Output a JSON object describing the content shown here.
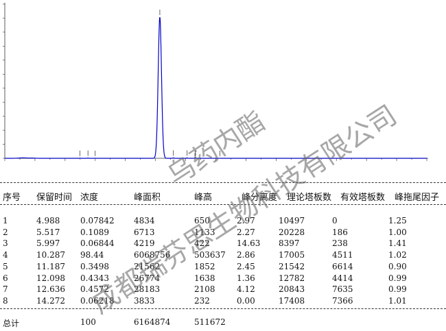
{
  "chart_data": {
    "type": "line",
    "title": "",
    "xlabel": "",
    "ylabel": "",
    "ylim": [
      0,
      550000
    ],
    "xlim": [
      0,
      28
    ],
    "grid": false,
    "line_color": "#0000c8",
    "peaks": [
      {
        "rt": 4.988,
        "height": 650
      },
      {
        "rt": 5.517,
        "height": 1133
      },
      {
        "rt": 5.997,
        "height": 422
      },
      {
        "rt": 10.287,
        "height": 503637
      },
      {
        "rt": 11.187,
        "height": 1852
      },
      {
        "rt": 12.098,
        "height": 1638
      },
      {
        "rt": 12.636,
        "height": 2108
      },
      {
        "rt": 14.272,
        "height": 232
      }
    ]
  },
  "table": {
    "headers": [
      "序号",
      "保留时间",
      "浓度",
      "峰面积",
      "峰高",
      "峰分离度",
      "理论塔板数",
      "有效塔板数",
      "峰拖尾因子"
    ],
    "rows": [
      [
        "1",
        "4.988",
        "0.07842",
        "4834",
        "650",
        "2.97",
        "10497",
        "0",
        "1.25"
      ],
      [
        "2",
        "5.517",
        "0.1089",
        "6713",
        "1133",
        "2.27",
        "20228",
        "186",
        "1.00"
      ],
      [
        "3",
        "5.997",
        "0.06844",
        "4219",
        "422",
        "14.63",
        "8397",
        "238",
        "1.41"
      ],
      [
        "4",
        "10.287",
        "98.44",
        "6068756",
        "503637",
        "2.86",
        "17005",
        "4511",
        "1.02"
      ],
      [
        "5",
        "11.187",
        "0.3498",
        "21562",
        "1852",
        "2.45",
        "21542",
        "6614",
        "0.90"
      ],
      [
        "6",
        "12.098",
        "0.4343",
        "26774",
        "1638",
        "1.36",
        "12782",
        "4414",
        "0.99"
      ],
      [
        "7",
        "12.636",
        "0.4572",
        "28183",
        "2108",
        "4.12",
        "20843",
        "7635",
        "0.99"
      ],
      [
        "8",
        "14.272",
        "0.06218",
        "3833",
        "232",
        "0.00",
        "17408",
        "7366",
        "1.01"
      ]
    ],
    "total_label": "总计",
    "total_conc": "100",
    "total_area": "6164874",
    "total_height": "511672"
  },
  "watermarks": {
    "product": "乌药内酯",
    "company": "成都瑞芬思生物科技有限公司"
  }
}
